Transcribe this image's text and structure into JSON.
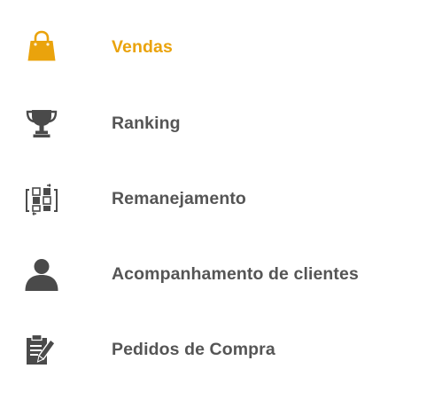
{
  "menu": {
    "items": [
      {
        "label": "Vendas",
        "icon": "shopping-bag-icon",
        "active": true
      },
      {
        "label": "Ranking",
        "icon": "trophy-icon",
        "active": false
      },
      {
        "label": "Remanejamento",
        "icon": "swap-blocks-icon",
        "active": false
      },
      {
        "label": "Acompanhamento de clientes",
        "icon": "person-icon",
        "active": false
      },
      {
        "label": "Pedidos de Compra",
        "icon": "clipboard-pen-icon",
        "active": false
      }
    ]
  },
  "colors": {
    "active": "#eaa30c",
    "text": "#555555",
    "icon": "#4a4a4a",
    "background": "#ffffff"
  }
}
